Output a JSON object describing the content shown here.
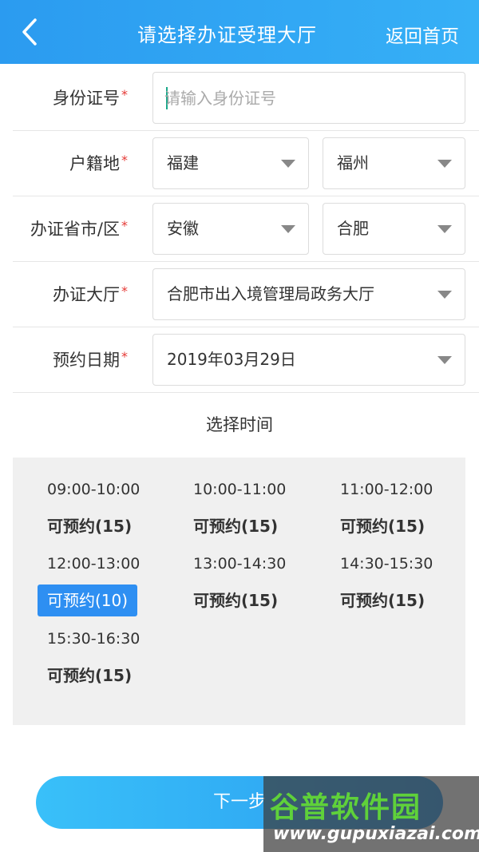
{
  "header": {
    "title": "请选择办证受理大厅",
    "home_label": "返回首页"
  },
  "form": {
    "required_mark": "*",
    "id_number": {
      "label": "身份证号",
      "placeholder": "请输入身份证号",
      "value": ""
    },
    "hukou": {
      "label": "户籍地",
      "province": "福建",
      "city": "福州"
    },
    "office_region": {
      "label": "办证省市/区",
      "province": "安徽",
      "city": "合肥"
    },
    "hall": {
      "label": "办证大厅",
      "value": "合肥市出入境管理局政务大厅"
    },
    "date": {
      "label": "预约日期",
      "value": "2019年03月29日"
    }
  },
  "time_section": {
    "title": "选择时间",
    "slots": [
      {
        "time": "09:00-10:00",
        "status": "可预约(15)",
        "selected": false
      },
      {
        "time": "10:00-11:00",
        "status": "可预约(15)",
        "selected": false
      },
      {
        "time": "11:00-12:00",
        "status": "可预约(15)",
        "selected": false
      },
      {
        "time": "12:00-13:00",
        "status": "可预约(10)",
        "selected": true
      },
      {
        "time": "13:00-14:30",
        "status": "可预约(15)",
        "selected": false
      },
      {
        "time": "14:30-15:30",
        "status": "可预约(15)",
        "selected": false
      },
      {
        "time": "15:30-16:30",
        "status": "可预约(15)",
        "selected": false
      }
    ]
  },
  "next_button": {
    "label": "下一步"
  },
  "watermark": {
    "logo_text": "谷普软件园",
    "url": "www.gupuxiazai.com"
  },
  "colors": {
    "header": "#2b9bf0",
    "accent": "#2e8ff2",
    "required": "#e53935",
    "slot_bg": "#f0f0f0"
  }
}
